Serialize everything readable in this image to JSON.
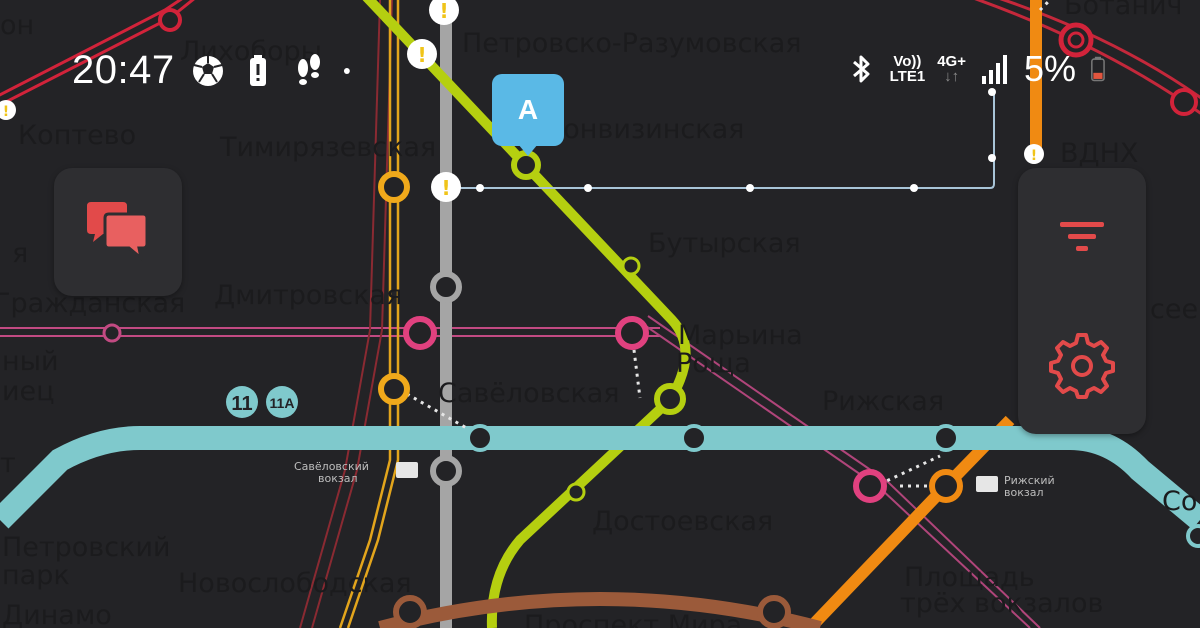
{
  "status_bar": {
    "time": "20:47",
    "left_icons": [
      "football-icon",
      "battery-alert-icon",
      "footsteps-icon",
      "dot-icon"
    ],
    "network_vo": "Vo))",
    "network_lte": "LTE1",
    "network_4g": "4G+",
    "network_arrows": "↓↑",
    "battery_percent": "5%",
    "battery_color": "#e2553e"
  },
  "map": {
    "stations": {
      "petrovsko": "Петровско-Разумовская",
      "fonvizinskaya": "Фонвизинская",
      "timiryazevskaya": "Тимирязевская",
      "butyrskaya": "Бутырская",
      "dmitrovskaya": "Дмитровская",
      "marina_1": "Марьина",
      "marina_2": "Роща",
      "savelovskaya": "Савёловская",
      "rizhskaya": "Рижская",
      "dostoevskaya": "Достоевская",
      "novoslobodskaya": "Новослободская",
      "vdnh": "ВДНХ",
      "koptevo": "Коптево",
      "likhobory": "Лихоборы",
      "grazhdanskaya": "Гражданская",
      "petrovsky_1": "Петровский",
      "petrovsky_2": "парк",
      "dinamo": "Динамо",
      "ploshchad_1": "Площадь",
      "ploshchad_2": "трёх вокзалов",
      "prospekt_mira": "Проспект Мира",
      "botanichesky": "Ботанич",
      "left_nyi": "ный",
      "left_iets": "иец",
      "left_t": "т",
      "left_ya": "я",
      "left_on": "он",
      "right_sol": "Со",
      "right_sees": "сеев"
    },
    "stations_small": {
      "savelovsky_vokzal_1": "Савёловский",
      "savelovsky_vokzal_2": "вокзал",
      "rizhsky_vokzal_1": "Рижский",
      "rizhsky_vokzal_2": "вокзал"
    },
    "badges": {
      "line11": "11",
      "line11a": "11А"
    },
    "marker_label": "A"
  },
  "colors": {
    "lime": "#b5cf10",
    "grey": "#a5a5a5",
    "orange": "#f08a12",
    "yellow": "#f0a91b",
    "pink": "#e0417f",
    "teal": "#7fc9cc",
    "red": "#d2233a",
    "brown": "#9b5a3a",
    "accent": "#e24a4a",
    "monorail": "#a8c4d8"
  },
  "controls": {
    "chat_icon": "chat-bubbles-icon",
    "filter_icon": "filter-icon",
    "settings_icon": "gear-icon"
  }
}
